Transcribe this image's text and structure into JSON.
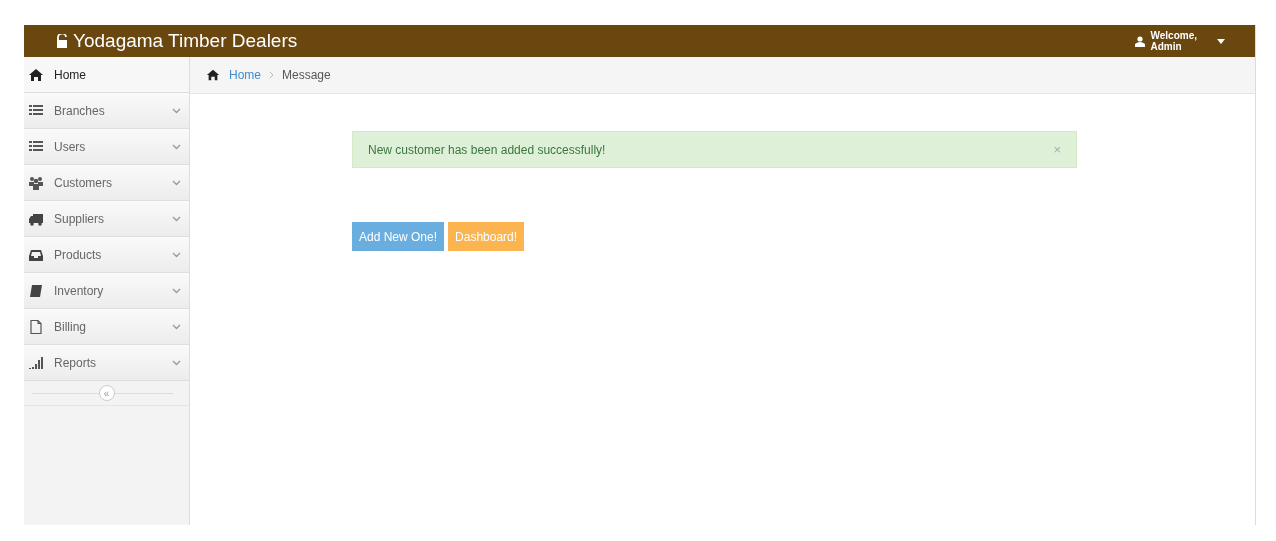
{
  "header": {
    "title": "Yodagama Timber Dealers",
    "user_greeting": "Welcome,",
    "user_name": "Admin"
  },
  "sidebar": {
    "items": [
      {
        "label": "Home",
        "selected": true,
        "expandable": false
      },
      {
        "label": "Branches",
        "selected": false,
        "expandable": true
      },
      {
        "label": "Users",
        "selected": false,
        "expandable": true
      },
      {
        "label": "Customers",
        "selected": false,
        "expandable": true
      },
      {
        "label": "Suppliers",
        "selected": false,
        "expandable": true
      },
      {
        "label": "Products",
        "selected": false,
        "expandable": true
      },
      {
        "label": "Inventory",
        "selected": false,
        "expandable": true
      },
      {
        "label": "Billing",
        "selected": false,
        "expandable": true
      },
      {
        "label": "Reports",
        "selected": false,
        "expandable": true
      }
    ],
    "collapse_glyph": "«"
  },
  "breadcrumb": [
    {
      "label": "Home",
      "link": true
    },
    {
      "label": "Message",
      "link": false
    }
  ],
  "alert": {
    "message": "New customer has been added successfully!",
    "close": "×"
  },
  "buttons": [
    {
      "label": "Add New One!",
      "kind": "primary"
    },
    {
      "label": "Dashboard!",
      "kind": "warning"
    }
  ]
}
